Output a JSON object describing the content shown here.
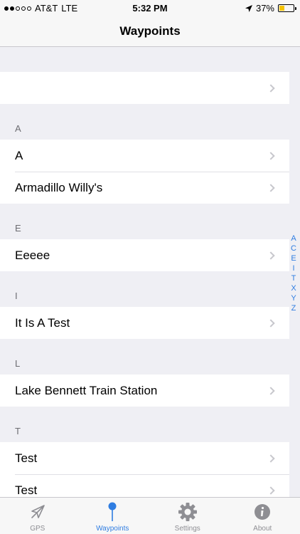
{
  "status_bar": {
    "carrier": "AT&T",
    "network": "LTE",
    "time": "5:32 PM",
    "battery": "37%",
    "signal_bars_filled": 2,
    "signal_bars_total": 5,
    "battery_level": 0.37
  },
  "nav": {
    "title": "Waypoints"
  },
  "sections": [
    {
      "header": "",
      "rows": [
        ""
      ]
    },
    {
      "header": "A",
      "rows": [
        "A",
        "Armadillo Willy's"
      ]
    },
    {
      "header": "E",
      "rows": [
        "Eeeee"
      ]
    },
    {
      "header": "I",
      "rows": [
        "It Is A Test"
      ]
    },
    {
      "header": "L",
      "rows": [
        "Lake Bennett Train Station"
      ]
    },
    {
      "header": "T",
      "rows": [
        "Test",
        "Test"
      ]
    }
  ],
  "index": [
    "A",
    "C",
    "E",
    "I",
    "T",
    "X",
    "Y",
    "Z"
  ],
  "tabs": [
    {
      "label": "GPS",
      "icon": "location-arrow-icon",
      "active": false
    },
    {
      "label": "Waypoints",
      "icon": "map-pin-icon",
      "active": true
    },
    {
      "label": "Settings",
      "icon": "gear-icon",
      "active": false
    },
    {
      "label": "About",
      "icon": "info-icon",
      "active": false
    }
  ],
  "colors": {
    "accent": "#2f7de1",
    "battery": "#f5c400",
    "inactive": "#8e8e93"
  }
}
